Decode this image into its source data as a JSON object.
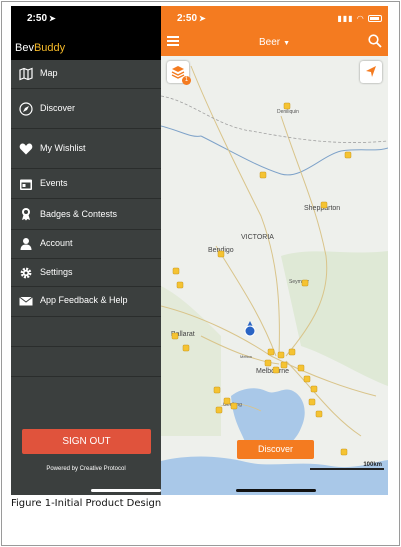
{
  "left_phone": {
    "status_time": "2:50",
    "brand_part1": "Bev",
    "brand_part2": "Buddy",
    "menu_items": [
      {
        "label": "Map",
        "icon": "map-icon"
      },
      {
        "label": "Discover",
        "icon": "compass-icon"
      },
      {
        "label": "My Wishlist",
        "icon": "heart-icon"
      },
      {
        "label": "Events",
        "icon": "calendar-icon"
      },
      {
        "label": "Badges & Contests",
        "icon": "award-icon"
      },
      {
        "label": "Account",
        "icon": "person-icon"
      },
      {
        "label": "Settings",
        "icon": "gear-icon"
      },
      {
        "label": "App Feedback & Help",
        "icon": "mail-icon"
      }
    ],
    "signout_label": "SIGN OUT",
    "powered_by": "Powered by Creative Protocol"
  },
  "right_phone": {
    "status_time": "2:50",
    "title": "Beer",
    "layers_badge": "1",
    "discover_label": "Discover",
    "scale_label": "100km",
    "map_labels": {
      "denliquin": "Deniliquin",
      "shepparton": "Shepparton",
      "victoria": "VICTORIA",
      "bendigo": "Bendigo",
      "seymour": "Seymour",
      "ballarat": "Ballarat",
      "melton": "Melton",
      "melbourne": "Melbourne",
      "geelong": "Geelong"
    }
  },
  "colors": {
    "accent": "#f47b20",
    "menu_bg": "#3b3f3e",
    "signout": "#e0533c",
    "brand_yellow": "#f5b928"
  },
  "caption": "Figure 1-Initial Product  Design"
}
